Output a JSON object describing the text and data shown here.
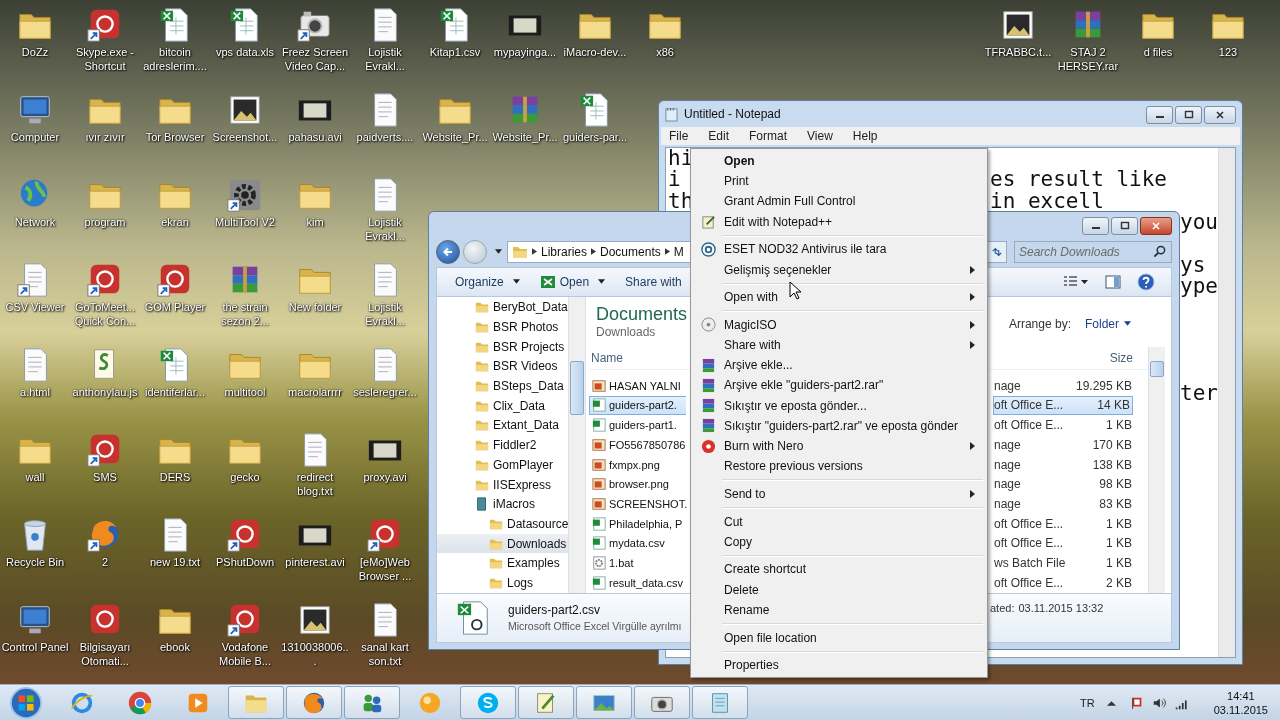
{
  "desktop": {
    "icon_rows": [
      [
        {
          "label": "DoZz",
          "kind": "folder",
          "shortcut": false
        },
        {
          "label": "Skype.exe - Shortcut",
          "kind": "app",
          "shortcut": true
        },
        {
          "label": "bitcoin adreslerim....",
          "kind": "spreadsheet",
          "shortcut": false
        },
        {
          "label": "vps data.xls",
          "kind": "spreadsheet",
          "shortcut": false
        },
        {
          "label": "Freez Screen Video Cap...",
          "kind": "camera",
          "shortcut": true
        },
        {
          "label": "Lojistik Evrakl...",
          "kind": "document",
          "shortcut": false
        },
        {
          "label": "Kitap1.csv",
          "kind": "spreadsheet",
          "shortcut": false
        },
        {
          "label": "mypayinga...",
          "kind": "film",
          "shortcut": false
        },
        {
          "label": "iMacro-dev...",
          "kind": "folder",
          "shortcut": false
        },
        {
          "label": "x86",
          "kind": "folder",
          "shortcut": false
        }
      ],
      [
        {
          "label": "Computer",
          "kind": "computer",
          "shortcut": false
        },
        {
          "label": "ıvır zıvır",
          "kind": "folder",
          "shortcut": false
        },
        {
          "label": "Tor Browser",
          "kind": "folder",
          "shortcut": false
        },
        {
          "label": "Screenshot...",
          "kind": "image",
          "shortcut": false
        },
        {
          "label": "pahasu.avi",
          "kind": "film",
          "shortcut": false
        },
        {
          "label": "paidverts....",
          "kind": "document",
          "shortcut": false
        },
        {
          "label": "Website_Pr...",
          "kind": "folder",
          "shortcut": false
        },
        {
          "label": "Website_Pr...",
          "kind": "archive",
          "shortcut": false
        },
        {
          "label": "guiders-par...",
          "kind": "spreadsheet",
          "shortcut": false
        }
      ],
      [
        {
          "label": "Network",
          "kind": "network",
          "shortcut": false
        },
        {
          "label": "program",
          "kind": "folder",
          "shortcut": false
        },
        {
          "label": "ekran",
          "kind": "folder",
          "shortcut": false
        },
        {
          "label": "MultiTool V2",
          "kind": "gear",
          "shortcut": true
        },
        {
          "label": "kim",
          "kind": "folder",
          "shortcut": false
        },
        {
          "label": "Lojistik Evrakl...",
          "kind": "document",
          "shortcut": false
        }
      ],
      [
        {
          "label": "CSV Viewer",
          "kind": "document",
          "shortcut": true
        },
        {
          "label": "GoToMeet... Quick Con...",
          "kind": "app",
          "shortcut": true
        },
        {
          "label": "GOM Player",
          "kind": "app",
          "shortcut": true
        },
        {
          "label": "the strain sezon 2...",
          "kind": "archive",
          "shortcut": false
        },
        {
          "label": "New folder",
          "kind": "folder",
          "shortcut": false
        },
        {
          "label": "Lojistik Evrakl...",
          "kind": "document",
          "shortcut": false
        }
      ],
      [
        {
          "label": "a.html",
          "kind": "document",
          "shortcut": false
        },
        {
          "label": "anthonylau.js",
          "kind": "script",
          "shortcut": false
        },
        {
          "label": "identiferlar...",
          "kind": "spreadsheet",
          "shortcut": false
        },
        {
          "label": "multitool",
          "kind": "folder",
          "shortcut": false
        },
        {
          "label": "macrolarrrr",
          "kind": "folder",
          "shortcut": false
        },
        {
          "label": "sesleregrer...",
          "kind": "document",
          "shortcut": false
        }
      ],
      [
        {
          "label": "wall",
          "kind": "folder",
          "shortcut": false
        },
        {
          "label": "SMS",
          "kind": "app",
          "shortcut": true
        },
        {
          "label": "DERS",
          "kind": "folder",
          "shortcut": false
        },
        {
          "label": "gecko",
          "kind": "folder",
          "shortcut": false
        },
        {
          "label": "redirect blog.txt",
          "kind": "document",
          "shortcut": false
        },
        {
          "label": "proxy.avi",
          "kind": "film",
          "shortcut": false
        }
      ],
      [
        {
          "label": "Recycle Bin",
          "kind": "bin",
          "shortcut": false
        },
        {
          "label": "2",
          "kind": "browser",
          "shortcut": true
        },
        {
          "label": "new 19.txt",
          "kind": "document",
          "shortcut": false
        },
        {
          "label": "PShutDown",
          "kind": "app",
          "shortcut": true
        },
        {
          "label": "pinterest.avi",
          "kind": "film",
          "shortcut": false
        },
        {
          "label": "[eMo]Web Browser ...",
          "kind": "app",
          "shortcut": true
        }
      ],
      [
        {
          "label": "Control Panel",
          "kind": "computer",
          "shortcut": false
        },
        {
          "label": "Bilgisayarı Otomati...",
          "kind": "app",
          "shortcut": false
        },
        {
          "label": "ebook",
          "kind": "folder",
          "shortcut": false
        },
        {
          "label": "Vodafone Mobile B...",
          "kind": "app",
          "shortcut": true
        },
        {
          "label": "1310038006...",
          "kind": "image",
          "shortcut": false
        },
        {
          "label": "sanal kart son.txt",
          "kind": "document",
          "shortcut": false
        }
      ]
    ],
    "right_icons": [
      {
        "label": "TFRABBC.t...",
        "kind": "image",
        "shortcut": false
      },
      {
        "label": "STAJ 2 HERSEY.rar",
        "kind": "archive",
        "shortcut": false
      },
      {
        "label": "d files",
        "kind": "folder",
        "shortcut": false
      },
      {
        "label": "123",
        "kind": "folder",
        "shortcut": false
      }
    ]
  },
  "notepad": {
    "title": "Untitled - Notepad",
    "menu": [
      "File",
      "Edit",
      "Format",
      "View",
      "Help"
    ],
    "lines": [
      {
        "kind": "text",
        "left": "hi"
      },
      {
        "kind": "text",
        "left": "i",
        "middle": "es result like"
      },
      {
        "kind": "text",
        "left": "th",
        "middle": "in excell"
      },
      {
        "kind": "text",
        "right": "you"
      },
      {
        "kind": "blank"
      },
      {
        "kind": "text",
        "right": "ys"
      },
      {
        "kind": "text",
        "right": "ype"
      },
      {
        "kind": "blank"
      },
      {
        "kind": "blank"
      },
      {
        "kind": "blank"
      },
      {
        "kind": "blank"
      },
      {
        "kind": "text",
        "right": "ter"
      }
    ]
  },
  "explorer": {
    "breadcrumb": [
      "Libraries",
      "Documents",
      "M"
    ],
    "search": {
      "placeholder": "Search Downloads"
    },
    "toolbar": [
      {
        "label": "Organize",
        "has_icon": false
      },
      {
        "label": "Open",
        "has_icon": true
      },
      {
        "label": "Share with",
        "has_icon": false
      }
    ],
    "tree": [
      {
        "label": "BeryBot_Data",
        "kind": "folder",
        "selected": false
      },
      {
        "label": "BSR Photos",
        "kind": "folder",
        "selected": false
      },
      {
        "label": "BSR Projects",
        "kind": "folder",
        "selected": false
      },
      {
        "label": "BSR Videos",
        "kind": "folder",
        "selected": false
      },
      {
        "label": "BSteps_Data",
        "kind": "folder",
        "selected": false
      },
      {
        "label": "Clix_Data",
        "kind": "folder",
        "selected": false
      },
      {
        "label": "Extant_Data",
        "kind": "folder",
        "selected": false
      },
      {
        "label": "Fiddler2",
        "kind": "folder",
        "selected": false
      },
      {
        "label": "GomPlayer",
        "kind": "folder",
        "selected": false
      },
      {
        "label": "IISExpress",
        "kind": "folder",
        "selected": false
      },
      {
        "label": "iMacros",
        "kind": "library",
        "selected": false,
        "children": [
          {
            "label": "Datasource",
            "kind": "folder",
            "selected": false
          },
          {
            "label": "Downloads",
            "kind": "folder",
            "selected": true
          },
          {
            "label": "Examples",
            "kind": "folder",
            "selected": false
          },
          {
            "label": "Logs",
            "kind": "folder",
            "selected": false
          }
        ]
      }
    ],
    "library": {
      "title": "Documents",
      "subtitle": "Downloads"
    },
    "arrange": {
      "label": "Arrange by:",
      "value": "Folder"
    },
    "columns": [
      {
        "label": "Name"
      },
      {
        "label": "Size"
      }
    ],
    "rows": [
      {
        "name": "HASAN YALNI",
        "type": "nage",
        "size": "19.295 KB",
        "kind": "image",
        "selected": false
      },
      {
        "name": "guiders-part2.",
        "type": "oft Office E...",
        "size": "14 KB",
        "kind": "spreadsheet",
        "selected": true
      },
      {
        "name": "guiders-part1.",
        "type": "oft Office E...",
        "size": "1 KB",
        "kind": "spreadsheet",
        "selected": false
      },
      {
        "name": "FO5567850786",
        "type": "nage",
        "size": "170 KB",
        "kind": "image",
        "selected": false
      },
      {
        "name": "fxmpx.png",
        "type": "nage",
        "size": "138 KB",
        "kind": "image",
        "selected": false
      },
      {
        "name": "browser.png",
        "type": "nage",
        "size": "98 KB",
        "kind": "image",
        "selected": false
      },
      {
        "name": "SCREENSHOT.",
        "type": "nage",
        "size": "83 KB",
        "kind": "image",
        "selected": false
      },
      {
        "name": "Philadelphia, P",
        "type": "oft Office E...",
        "size": "1 KB",
        "kind": "spreadsheet",
        "selected": false
      },
      {
        "name": "mydata.csv",
        "type": "oft Office E...",
        "size": "1 KB",
        "kind": "spreadsheet",
        "selected": false
      },
      {
        "name": "1.bat",
        "type": "ws Batch File",
        "size": "1 KB",
        "kind": "batch",
        "selected": false
      },
      {
        "name": "result_data.csv",
        "type": "oft Office E...",
        "size": "2 KB",
        "kind": "spreadsheet",
        "selected": false
      }
    ],
    "details": {
      "name": "guiders-part2.csv",
      "type": "Microsoft Office Excel Virgülle ayrılmı",
      "date_label": "ated:",
      "date": "03.11.2015 13:32"
    }
  },
  "context_menu": {
    "items": [
      {
        "kind": "item",
        "label": "Open",
        "bold": true,
        "submenu": false
      },
      {
        "kind": "item",
        "label": "Print",
        "bold": false,
        "submenu": false
      },
      {
        "kind": "item",
        "label": "Grant Admin Full Control",
        "bold": false,
        "submenu": false
      },
      {
        "kind": "notepad",
        "label": "Edit with Notepad++",
        "bold": false,
        "submenu": false
      },
      {
        "kind": "separator"
      },
      {
        "kind": "eset",
        "label": "ESET NOD32 Antivirus ile tara",
        "bold": false,
        "submenu": false
      },
      {
        "kind": "item",
        "label": "Gelişmiş seçenekler",
        "bold": false,
        "submenu": true
      },
      {
        "kind": "separator"
      },
      {
        "kind": "item",
        "label": "Open with",
        "bold": false,
        "submenu": true
      },
      {
        "kind": "separator"
      },
      {
        "kind": "disc",
        "label": "MagicISO",
        "bold": false,
        "submenu": true
      },
      {
        "kind": "item",
        "label": "Share with",
        "bold": false,
        "submenu": true
      },
      {
        "kind": "archive",
        "label": "Arşive ekle...",
        "bold": false,
        "submenu": false
      },
      {
        "kind": "archive",
        "label": "Arşive ekle \"guiders-part2.rar\"",
        "bold": false,
        "submenu": false
      },
      {
        "kind": "archive",
        "label": "Sıkıştır ve eposta gönder...",
        "bold": false,
        "submenu": false
      },
      {
        "kind": "archive",
        "label": "Sıkıştır \"guiders-part2.rar\" ve eposta gönder",
        "bold": false,
        "submenu": false
      },
      {
        "kind": "nero",
        "label": "Burn with Nero",
        "bold": false,
        "submenu": true
      },
      {
        "kind": "item",
        "label": "Restore previous versions",
        "bold": false,
        "submenu": false
      },
      {
        "kind": "separator"
      },
      {
        "kind": "item",
        "label": "Send to",
        "bold": false,
        "submenu": true
      },
      {
        "kind": "separator"
      },
      {
        "kind": "item",
        "label": "Cut",
        "bold": false,
        "submenu": false
      },
      {
        "kind": "item",
        "label": "Copy",
        "bold": false,
        "submenu": false
      },
      {
        "kind": "separator"
      },
      {
        "kind": "item",
        "label": "Create shortcut",
        "bold": false,
        "submenu": false
      },
      {
        "kind": "item",
        "label": "Delete",
        "bold": false,
        "submenu": false
      },
      {
        "kind": "item",
        "label": "Rename",
        "bold": false,
        "submenu": false
      },
      {
        "kind": "separator"
      },
      {
        "kind": "item",
        "label": "Open file location",
        "bold": false,
        "submenu": false
      },
      {
        "kind": "separator"
      },
      {
        "kind": "item",
        "label": "Properties",
        "bold": false,
        "submenu": false
      }
    ]
  },
  "taskbar": {
    "apps": [
      {
        "kind": "ie",
        "running": false
      },
      {
        "kind": "chrome",
        "running": false
      },
      {
        "kind": "media",
        "running": false
      },
      {
        "kind": "explorer",
        "running": true
      },
      {
        "kind": "firefox",
        "running": true
      },
      {
        "kind": "messenger",
        "running": true
      },
      {
        "kind": "gom",
        "running": false
      },
      {
        "kind": "skype",
        "running": true
      },
      {
        "kind": "notepadpp",
        "running": true
      },
      {
        "kind": "photos",
        "running": true
      },
      {
        "kind": "camera",
        "running": true
      },
      {
        "kind": "notepad",
        "running": true
      }
    ],
    "tray": {
      "language": "TR",
      "time": "14:41",
      "date": "03.11.2015"
    }
  }
}
